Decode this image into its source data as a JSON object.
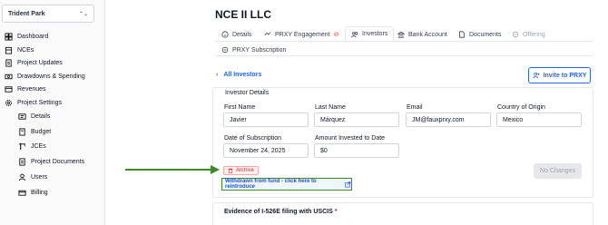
{
  "sidebar": {
    "project_name": "Trident Park",
    "items": [
      {
        "label": "Dashboard",
        "icon": "dashboard-icon"
      },
      {
        "label": "NCEs",
        "icon": "building-icon"
      },
      {
        "label": "Project Updates",
        "icon": "updates-icon"
      },
      {
        "label": "Drawdowns & Spending",
        "icon": "money-icon"
      },
      {
        "label": "Revenues",
        "icon": "revenues-icon"
      },
      {
        "label": "Project Settings",
        "icon": "gear-icon"
      }
    ],
    "sub_items": [
      {
        "label": "Details",
        "icon": "details-icon"
      },
      {
        "label": "Budget",
        "icon": "budget-icon"
      },
      {
        "label": "JCEs",
        "icon": "crane-icon"
      },
      {
        "label": "Project Documents",
        "icon": "documents-icon"
      },
      {
        "label": "Users",
        "icon": "user-icon"
      },
      {
        "label": "Billing",
        "icon": "billing-icon"
      }
    ]
  },
  "page": {
    "title": "NCE II LLC"
  },
  "tabs": [
    {
      "label": "Details"
    },
    {
      "label": "PRXY Engagement"
    },
    {
      "label": "Investors",
      "active": true
    },
    {
      "label": "Bank Account"
    },
    {
      "label": "Documents"
    },
    {
      "label": "Offering",
      "disabled": true
    },
    {
      "label": "PRXY Subscription"
    }
  ],
  "investor": {
    "back_label": "All Investors",
    "invite_label": "Invite to PRXY",
    "section_title": "Investor Details",
    "fields": {
      "first_name": {
        "label": "First Name",
        "value": "Javier"
      },
      "last_name": {
        "label": "Last Name",
        "value": "Márquez"
      },
      "email": {
        "label": "Email",
        "value": "JM@fauxprxy.com"
      },
      "country": {
        "label": "Country of Origin",
        "value": "Mexico"
      },
      "subscription_date": {
        "label": "Date of Subscription",
        "value": "November 24, 2025"
      },
      "amount": {
        "label": "Amount Invested to Date",
        "value": "$0"
      }
    },
    "archive_label": "Archive",
    "no_changes_label": "No Changes",
    "withdrawn_label": "Withdrawn from fund - click here to reintroduce"
  },
  "evidence": {
    "label": "Evidence of I-526E filing with USCIS",
    "required_mark": "*"
  },
  "colors": {
    "accent": "#2563eb",
    "danger": "#dc2626",
    "highlight": "#3d8a2a"
  }
}
